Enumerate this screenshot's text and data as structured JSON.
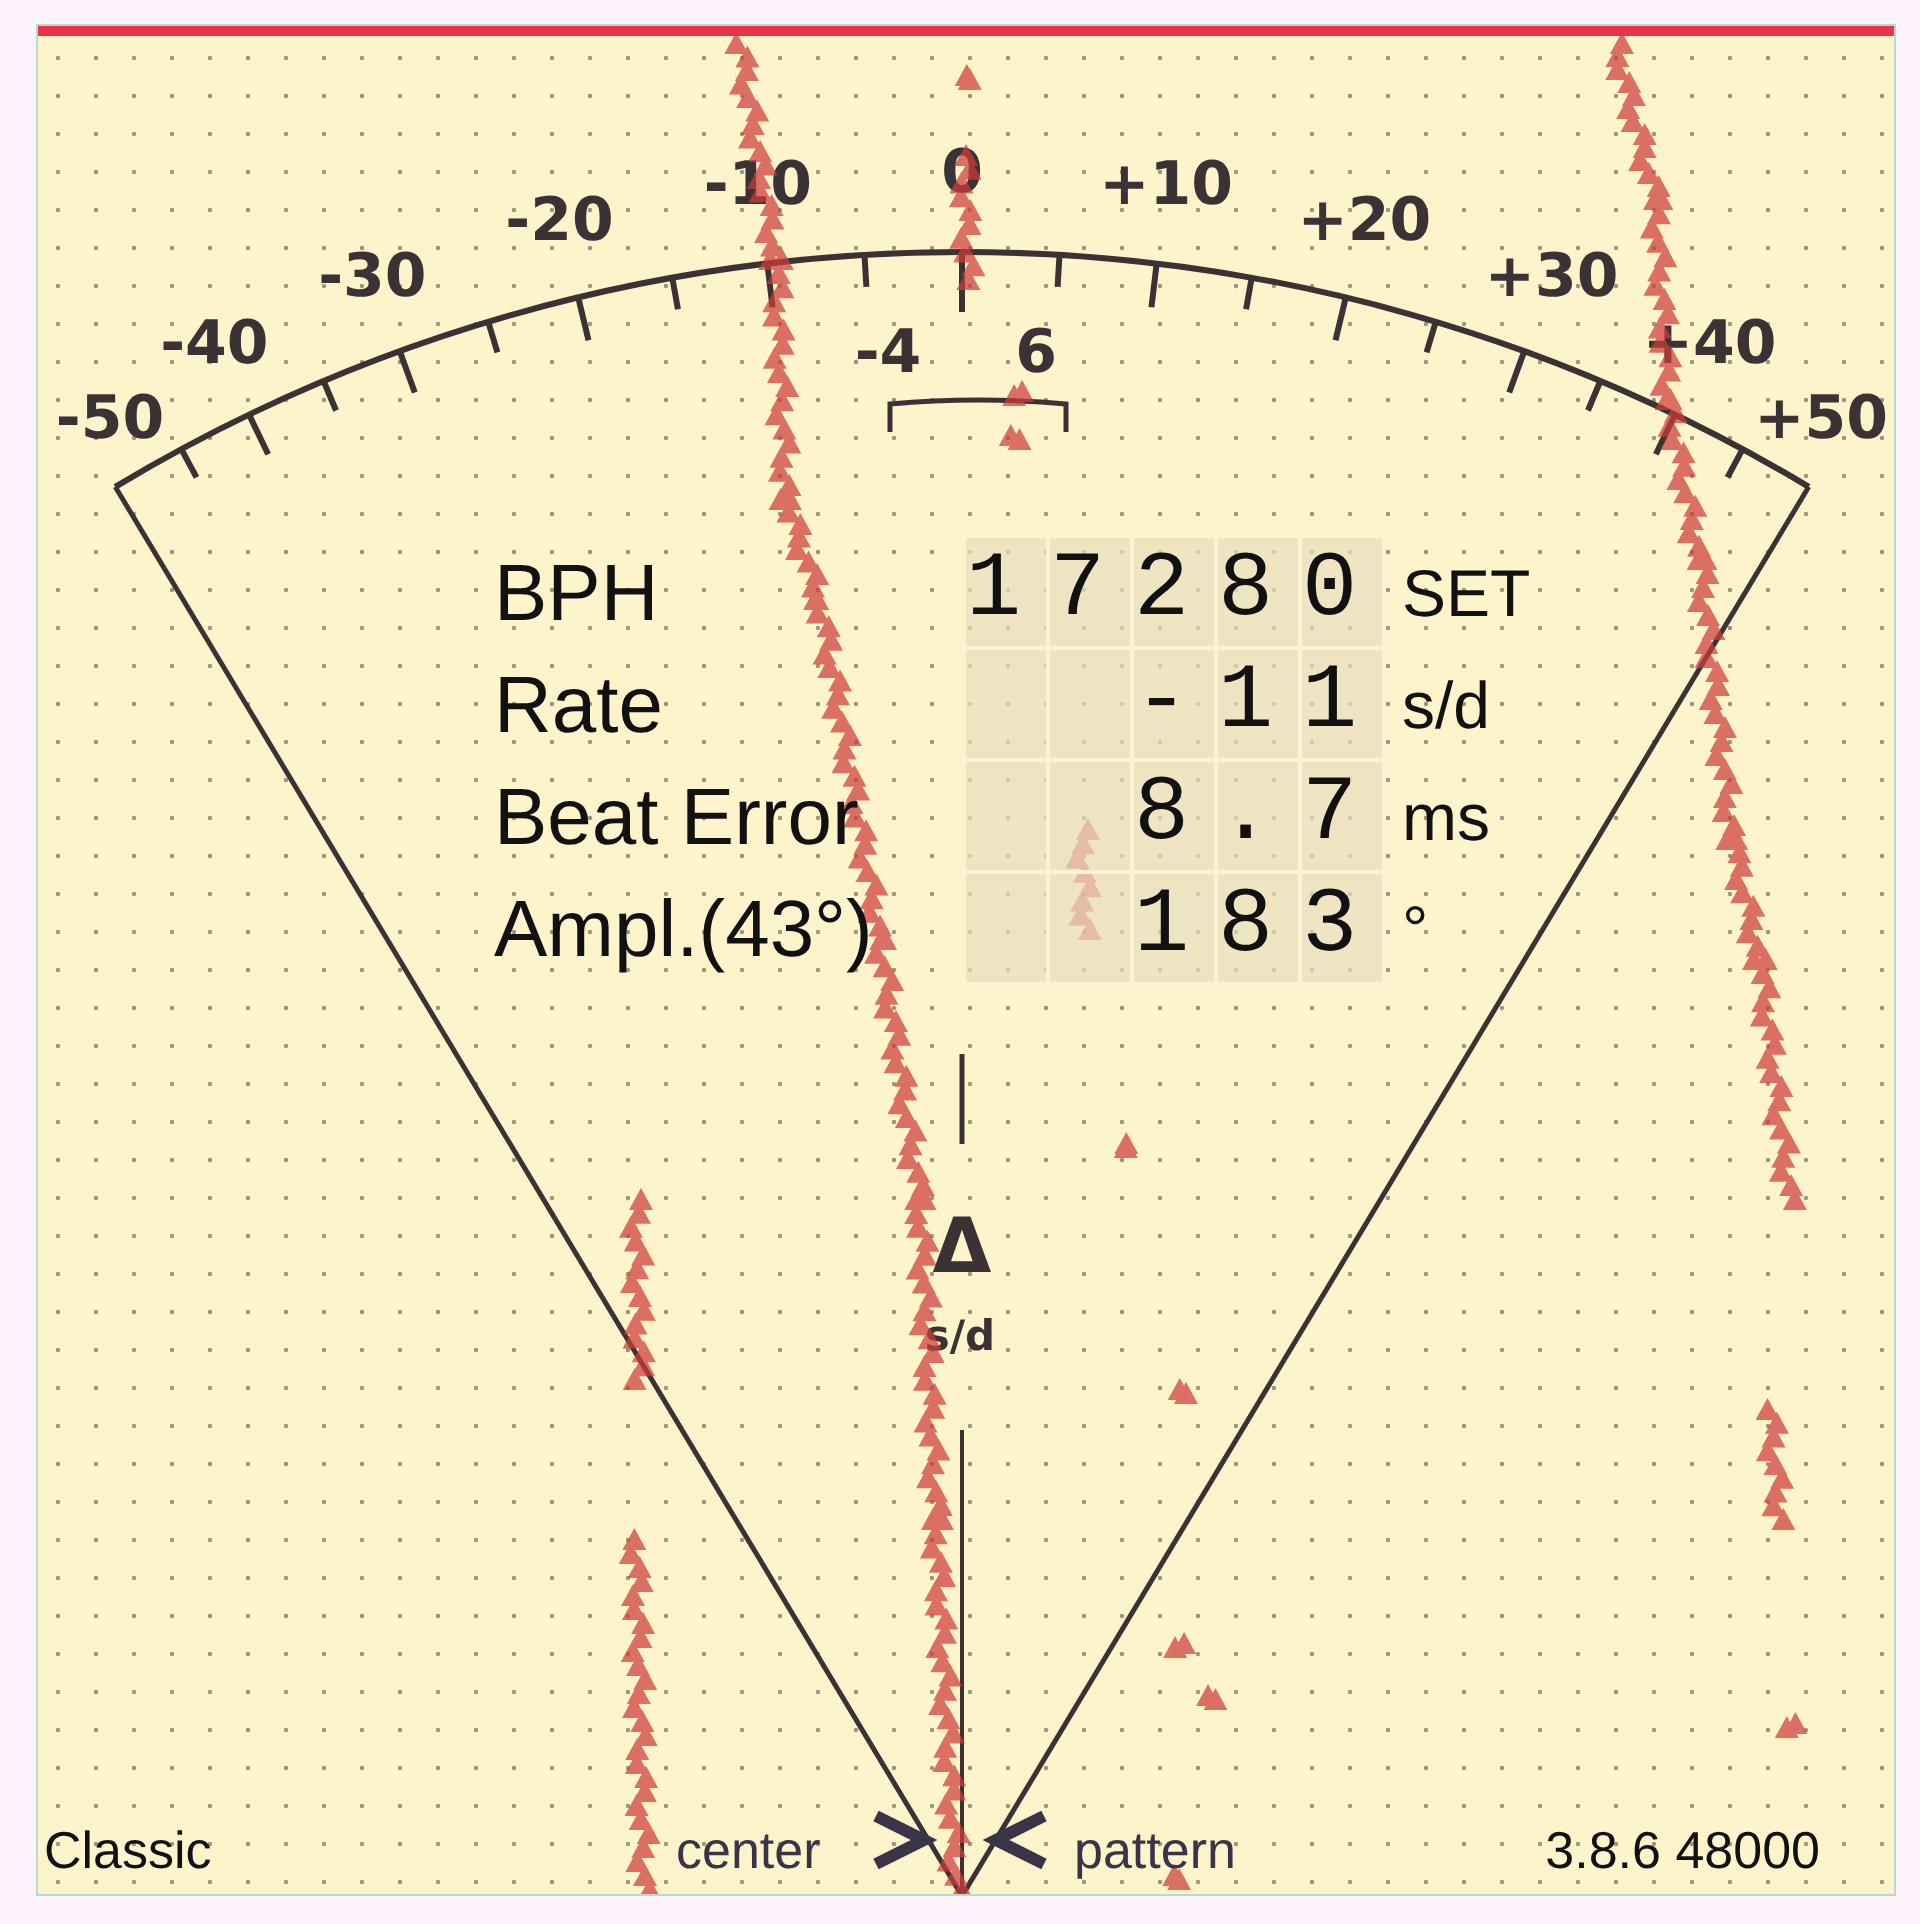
{
  "dial": {
    "scale_labels": [
      "-50",
      "-40",
      "-30",
      "-20",
      "-10",
      "0",
      "+10",
      "+20",
      "+30",
      "+40",
      "+50"
    ],
    "inner_labels": [
      "-4",
      "6"
    ],
    "center_mark": "Δ",
    "center_unit": "s/d"
  },
  "readouts": [
    {
      "label": "BPH",
      "value": "17280",
      "unit": "SET"
    },
    {
      "label": "Rate",
      "value": "-11",
      "unit": "s/d"
    },
    {
      "label": "Beat Error",
      "value": "8.7",
      "unit": "ms"
    },
    {
      "label": "Ampl.(43°)",
      "value": "183",
      "unit": "°"
    }
  ],
  "footer": {
    "mode": "Classic",
    "left_pointer": "center",
    "right_pointer": "pattern",
    "version": "3.8.6 48000"
  }
}
